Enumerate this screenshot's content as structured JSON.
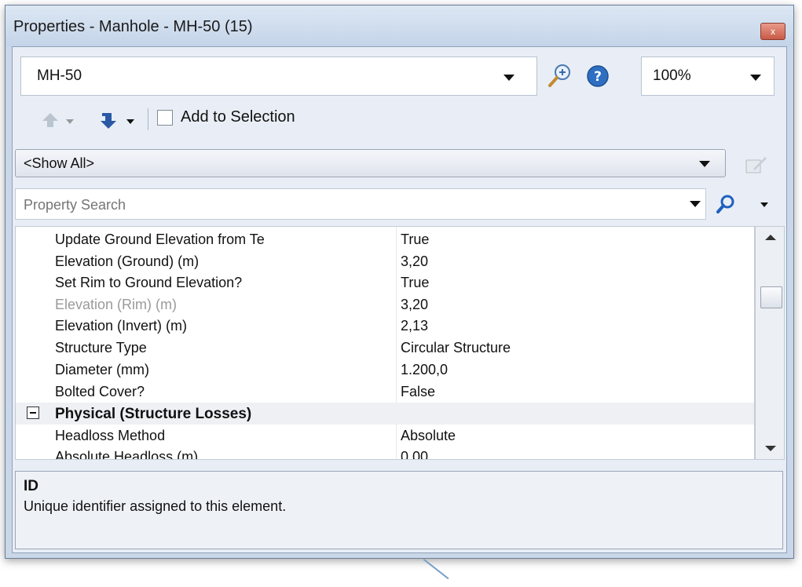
{
  "window": {
    "title": "Properties - Manhole - MH-50 (15)",
    "close_label": "x"
  },
  "element_selector": {
    "value": "MH-50"
  },
  "zoom": {
    "value": "100%"
  },
  "toolbar": {
    "add_to_selection_label": "Add to Selection"
  },
  "filter": {
    "value": "<Show All>"
  },
  "search": {
    "placeholder": "Property Search"
  },
  "properties": [
    {
      "name": "Update Ground Elevation from Te",
      "value": "True"
    },
    {
      "name": "Elevation (Ground) (m)",
      "value": "3,20"
    },
    {
      "name": "Set Rim to Ground Elevation?",
      "value": "True"
    },
    {
      "name": "Elevation (Rim) (m)",
      "value": "3,20",
      "disabled": true
    },
    {
      "name": "Elevation (Invert) (m)",
      "value": "2,13"
    },
    {
      "name": "Structure Type",
      "value": "Circular Structure"
    },
    {
      "name": "Diameter (mm)",
      "value": "1.200,0"
    },
    {
      "name": "Bolted Cover?",
      "value": "False"
    }
  ],
  "section": {
    "name": "Physical (Structure Losses)"
  },
  "section_properties": [
    {
      "name": "Headloss Method",
      "value": "Absolute"
    },
    {
      "name": "Absolute Headloss (m)",
      "value": "0,00"
    }
  ],
  "description": {
    "title": "ID",
    "text": "Unique identifier assigned to this element."
  },
  "icons": [
    "zoom-in-icon",
    "help-icon",
    "navigate-up-icon",
    "navigate-down-icon",
    "edit-icon",
    "search-icon"
  ]
}
